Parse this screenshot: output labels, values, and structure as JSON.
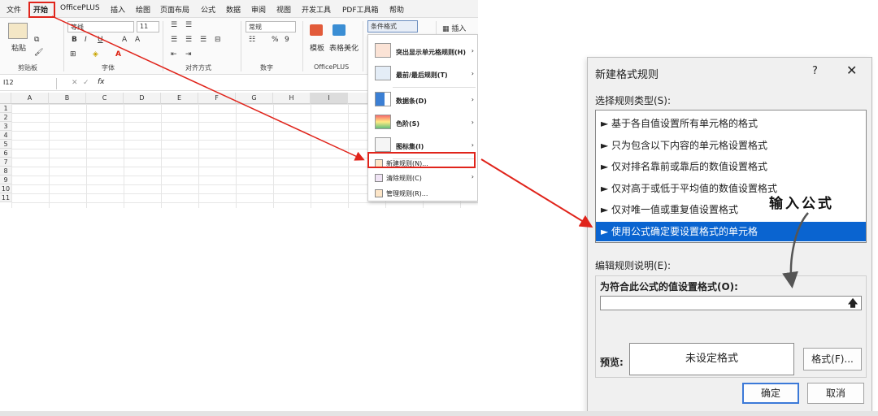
{
  "menu": [
    "文件",
    "开始",
    "OfficePLUS",
    "插入",
    "绘图",
    "页面布局",
    "公式",
    "数据",
    "审阅",
    "视图",
    "开发工具",
    "PDF工具箱",
    "帮助"
  ],
  "ribbon": {
    "paste": "粘贴",
    "clipboard": "剪贴板",
    "font_name": "等线",
    "font_size": "11",
    "font_group": "字体",
    "align_group": "对齐方式",
    "number_format": "常规",
    "number_group": "数字",
    "template": "模板",
    "table_beautify": "表格美化",
    "officeplus_group": "OfficePLUS",
    "cond_format": "条件格式",
    "insert": "插入"
  },
  "namebox": "I12",
  "fx": "fx",
  "columns": [
    "A",
    "B",
    "C",
    "D",
    "E",
    "F",
    "G",
    "H",
    "I"
  ],
  "rows": [
    "1",
    "2",
    "3",
    "4",
    "5",
    "6",
    "7",
    "8",
    "9",
    "10",
    "11"
  ],
  "cf_menu": {
    "highlight": "突出显示单元格规则(H)",
    "topbottom": "最前/最后规则(T)",
    "databar": "数据条(D)",
    "colorscale": "色阶(S)",
    "iconset": "图标集(I)",
    "new_rule": "新建规则(N)...",
    "clear_rules": "清除规则(C)",
    "manage_rules": "管理规则(R)..."
  },
  "dialog": {
    "title": "新建格式规则",
    "help": "?",
    "close": "✕",
    "select_type_label": "选择规则类型(S):",
    "rule_types": [
      "► 基于各自值设置所有单元格的格式",
      "► 只为包含以下内容的单元格设置格式",
      "► 仅对排名靠前或靠后的数值设置格式",
      "► 仅对高于或低于平均值的数值设置格式",
      "► 仅对唯一值或重复值设置格式",
      "► 使用公式确定要设置格式的单元格"
    ],
    "edit_desc_label": "编辑规则说明(E):",
    "formula_label": "为符合此公式的值设置格式(O):",
    "formula_value": "",
    "upload_icon": "🡅",
    "preview_label": "预览:",
    "preview_text": "未设定格式",
    "format_button": "格式(F)...",
    "ok": "确定",
    "cancel": "取消"
  },
  "annotation": "输入公式",
  "colors": {
    "red": "#e0241b",
    "selected": "#0a64d0"
  }
}
